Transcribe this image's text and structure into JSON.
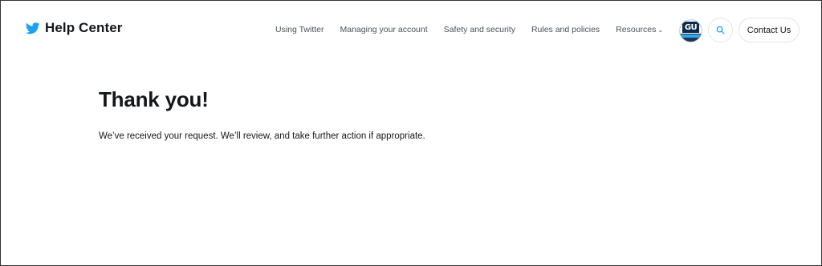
{
  "header": {
    "brand_title": "Help Center",
    "nav": [
      {
        "label": "Using Twitter"
      },
      {
        "label": "Managing your account"
      },
      {
        "label": "Safety and security"
      },
      {
        "label": "Rules and policies"
      },
      {
        "label": "Resources"
      }
    ],
    "avatar_text": "GU",
    "contact_label": "Contact Us"
  },
  "main": {
    "heading": "Thank you!",
    "message": "We’ve received your request. We’ll review, and take further action if appropriate."
  },
  "colors": {
    "brand_blue": "#1da1f2",
    "text": "#14171a",
    "nav_text": "#4a5259",
    "border": "#e1e8ed"
  },
  "icons": [
    "twitter-bird-icon",
    "chevron-down-icon",
    "search-icon"
  ]
}
